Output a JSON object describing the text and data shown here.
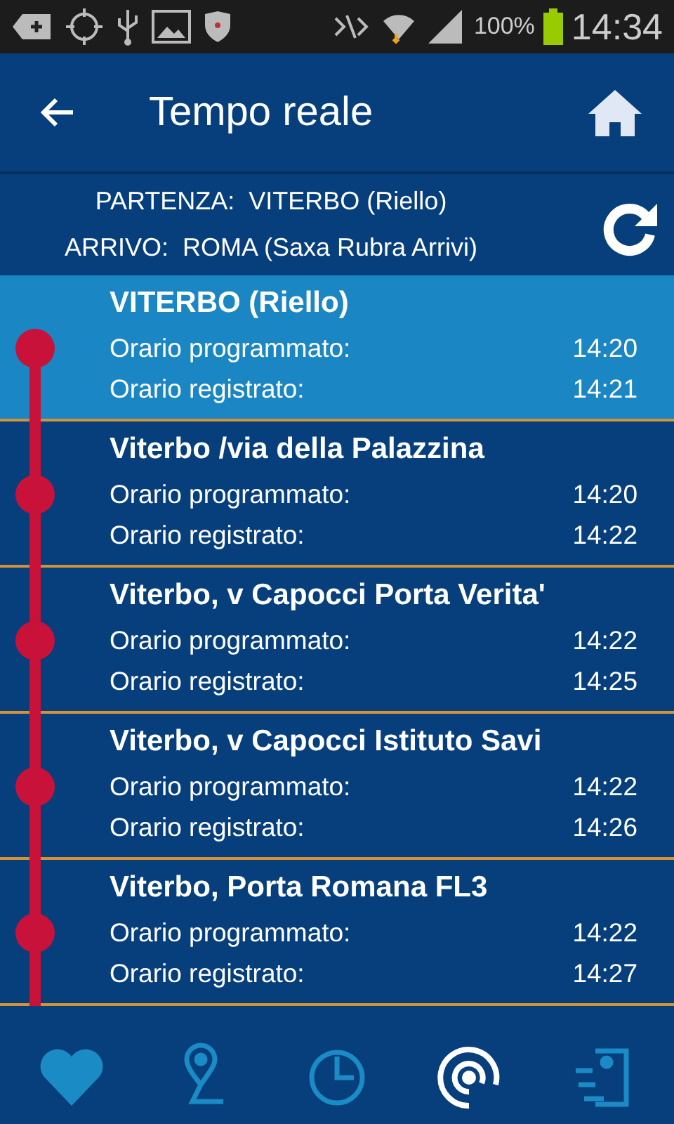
{
  "status_bar": {
    "battery": "100%",
    "time": "14:34"
  },
  "header": {
    "title": "Tempo reale"
  },
  "route": {
    "departure_label": "PARTENZA:",
    "departure": "VITERBO (Riello)",
    "arrival_label": "ARRIVO:",
    "arrival": "ROMA (Saxa Rubra Arrivi)"
  },
  "stops": [
    {
      "name": "VITERBO (Riello)",
      "selected": true,
      "times": [
        {
          "label": "Orario programmato:",
          "time": "14:20"
        },
        {
          "label": "Orario registrato:",
          "time": "14:21"
        }
      ]
    },
    {
      "name": "Viterbo /via della Palazzina",
      "selected": false,
      "times": [
        {
          "label": "Orario programmato:",
          "time": "14:20"
        },
        {
          "label": "Orario registrato:",
          "time": "14:22"
        }
      ]
    },
    {
      "name": "Viterbo, v Capocci Porta Verita'",
      "selected": false,
      "times": [
        {
          "label": "Orario programmato:",
          "time": "14:22"
        },
        {
          "label": "Orario registrato:",
          "time": "14:25"
        }
      ]
    },
    {
      "name": "Viterbo, v Capocci Istituto Savi",
      "selected": false,
      "times": [
        {
          "label": "Orario programmato:",
          "time": "14:22"
        },
        {
          "label": "Orario registrato:",
          "time": "14:26"
        }
      ]
    },
    {
      "name": "Viterbo, Porta Romana FL3",
      "selected": false,
      "times": [
        {
          "label": "Orario programmato:",
          "time": "14:22"
        },
        {
          "label": "Orario registrato:",
          "time": "14:27"
        }
      ]
    }
  ],
  "nav": [
    {
      "kind": "favorites",
      "selected": false
    },
    {
      "kind": "route",
      "selected": false
    },
    {
      "kind": "schedule",
      "selected": false
    },
    {
      "kind": "realtime",
      "selected": true
    },
    {
      "kind": "exit",
      "selected": false
    }
  ]
}
